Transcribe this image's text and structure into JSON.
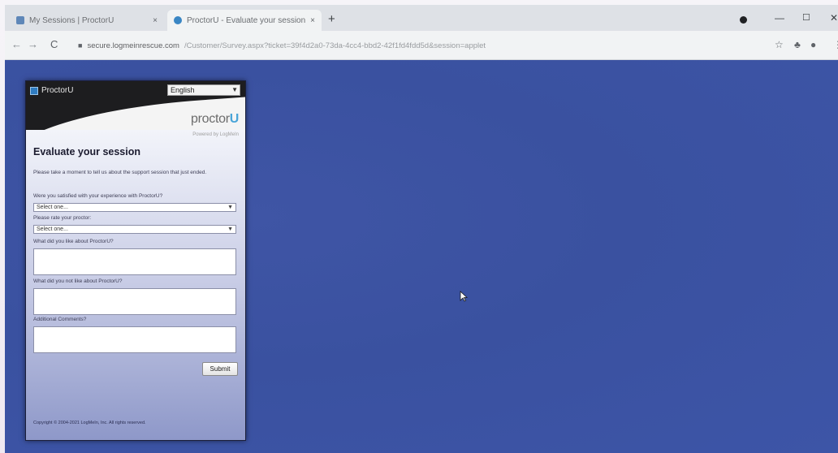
{
  "browser": {
    "tabs": [
      {
        "title": "My Sessions | ProctorU",
        "close": "×"
      },
      {
        "title": "ProctorU - Evaluate your session",
        "close": "×"
      }
    ],
    "new_tab": "+",
    "address": {
      "host": "secure.logmeinrescue.com",
      "path": "/Customer/Survey.aspx?ticket=39f4d2a0-73da-4cc4-bbd2-42f1fd4fdd5d&session=applet"
    },
    "window_controls": {
      "minimize": "—",
      "maximize": "☐",
      "close": "✕"
    }
  },
  "panel": {
    "brand_name": "ProctorU",
    "language": "English",
    "logo_text": "proctor",
    "logo_accent": "U",
    "powered_by": "Powered by LogMeIn",
    "title": "Evaluate your session",
    "intro": "Please take a moment to tell us about the support session that just ended.",
    "questions": {
      "q1_label": "Were you satisfied with your experience with ProctorU?",
      "q1_value": "Select one...",
      "q2_label": "Please rate your proctor:",
      "q2_value": "Select one...",
      "q3_label": "What did you like about ProctorU?",
      "q4_label": "What did you not like about ProctorU?",
      "q5_label": "Additional Comments?"
    },
    "submit_label": "Submit",
    "copyright": "Copyright © 2004-2021 LogMeIn, Inc. All rights reserved."
  },
  "colors": {
    "page_background": "#3d55a7",
    "panel_header": "#1d1d1f",
    "logo_accent": "#4aa5d8"
  }
}
